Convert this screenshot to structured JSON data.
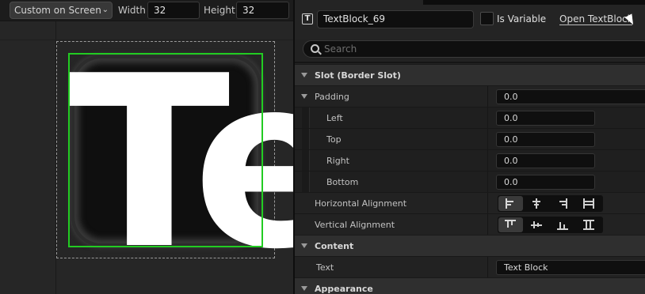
{
  "toolbar": {
    "screen_mode": "Custom on Screen",
    "width_label": "Width",
    "width_value": "32",
    "height_label": "Height",
    "height_value": "32"
  },
  "canvas": {
    "preview_text": "Te",
    "selection_color": "#22cc22"
  },
  "details": {
    "widget_type_icon": "T",
    "widget_name": "TextBlock_69",
    "is_variable_label": "Is Variable",
    "is_variable_checked": false,
    "open_link": "Open TextBlock",
    "search_placeholder": "Search",
    "sections": {
      "slot": {
        "title": "Slot (Border Slot)",
        "padding": {
          "label": "Padding",
          "value": "0.0",
          "left_label": "Left",
          "left_value": "0.0",
          "top_label": "Top",
          "top_value": "0.0",
          "right_label": "Right",
          "right_value": "0.0",
          "bottom_label": "Bottom",
          "bottom_value": "0.0"
        },
        "horizontal_alignment_label": "Horizontal Alignment",
        "horizontal_alignment_selected": "left",
        "vertical_alignment_label": "Vertical Alignment",
        "vertical_alignment_selected": "top"
      },
      "content": {
        "title": "Content",
        "text_label": "Text",
        "text_value": "Text Block"
      },
      "appearance": {
        "title": "Appearance"
      }
    }
  }
}
